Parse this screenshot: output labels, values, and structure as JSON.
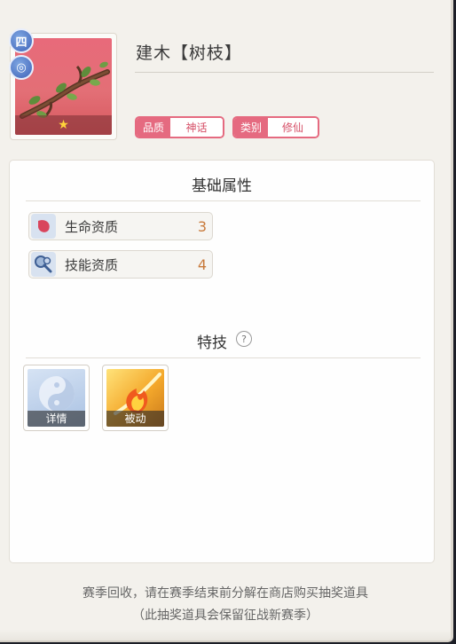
{
  "item": {
    "name": "建木【树枝】",
    "stars": "★",
    "side_badges": [
      "四",
      "◎"
    ],
    "tags": [
      {
        "key": "品质",
        "value": "神话"
      },
      {
        "key": "类别",
        "value": "修仙"
      }
    ]
  },
  "base_attrs": {
    "title": "基础属性",
    "rows": [
      {
        "label": "生命资质",
        "value": "3",
        "icon": "life-petal-icon"
      },
      {
        "label": "技能资质",
        "value": "4",
        "icon": "skill-search-icon"
      }
    ]
  },
  "skills": {
    "title": "特技",
    "help_glyph": "?",
    "items": [
      {
        "caption": "详情",
        "icon": "yin-yang-icon"
      },
      {
        "caption": "被动",
        "icon": "fire-slash-icon"
      }
    ]
  },
  "footer": {
    "line1": "赛季回收，请在赛季结束前分解在商店购买抽奖道具",
    "line2": "（此抽奖道具会保留征战新赛季）"
  },
  "colors": {
    "tag_accent": "#e56a80",
    "value_orange": "#c8793a",
    "panel_bg": "#f3f1ec"
  }
}
